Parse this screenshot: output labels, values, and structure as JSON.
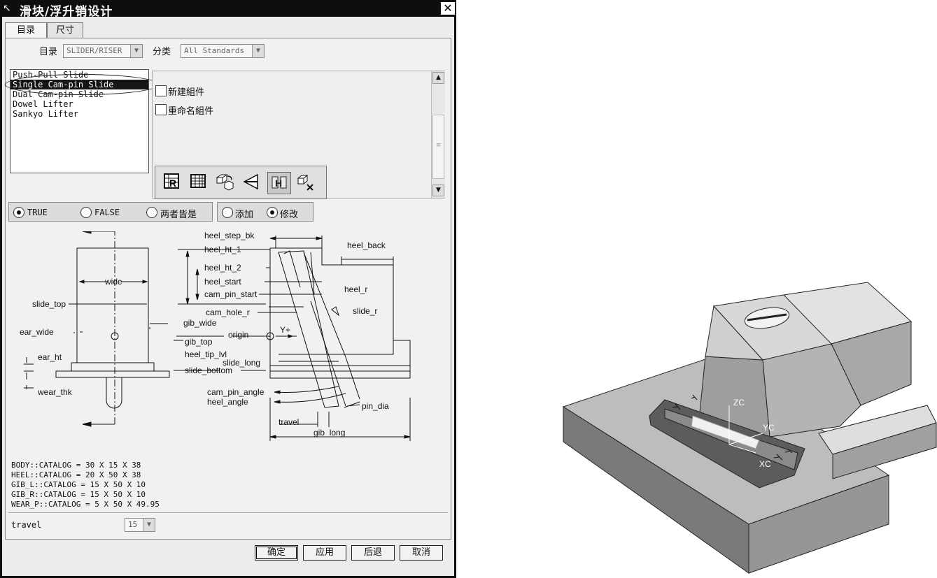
{
  "window": {
    "title": "滑块/浮升销设计",
    "close_glyph": "✕"
  },
  "tabs": [
    {
      "label": "目录",
      "active": true
    },
    {
      "label": "尺寸",
      "active": false
    }
  ],
  "catalog_row": {
    "catalog_label": "目录",
    "catalog_value": "SLIDER/RISER",
    "category_label": "分类",
    "category_value": "All Standards"
  },
  "list": {
    "items": [
      "Push-Pull Slide",
      "Single Cam-pin Slide",
      "Dual Cam-pin Slide",
      "Dowel Lifter",
      "Sankyo Lifter"
    ],
    "selected_index": 1
  },
  "options": {
    "new_component": "新建組件",
    "rename_component": "重命名組件"
  },
  "toolbar_icons": [
    "edit-register-icon",
    "table-icon",
    "redefine-component-icon",
    "plane-icon",
    "view-icon",
    "delete-component-icon"
  ],
  "radios_left": {
    "true_label": "TRUE",
    "false_label": "FALSE",
    "both_label": "两者皆是",
    "selected": "TRUE"
  },
  "radios_right": {
    "add_label": "添加",
    "modify_label": "修改",
    "selected": "修改"
  },
  "diagram_labels": {
    "wide": "wide",
    "slide_top": "slide_top",
    "ear_wide": "ear_wide",
    "ear_ht": "ear_ht",
    "wear_thk": "wear_thk",
    "gib_wide": "gib_wide",
    "gib_top": "gib_top",
    "slide_bottom": "slide_bottom",
    "origin": "origin",
    "y_plus": "Y+",
    "heel_step_bk": "heel_step_bk",
    "heel_ht_1": "heel_ht_1",
    "heel_back": "heel_back",
    "heel_ht_2": "heel_ht_2",
    "heel_start": "heel_start",
    "cam_pin_start": "cam_pin_start",
    "heel_r": "heel_r",
    "cam_hole_r": "cam_hole_r",
    "slide_r": "slide_r",
    "heel_tip_lvl": "heel_tip_lvl",
    "slide_long": "slide_long",
    "cam_pin_angle": "cam_pin_angle",
    "heel_angle": "heel_angle",
    "pin_dia": "pin_dia",
    "travel": "travel",
    "gib_long": "gib_long"
  },
  "catalog_lines": [
    "BODY::CATALOG = 30 X 15 X 38",
    "HEEL::CATALOG = 20 X 50 X 38",
    "GIB_L::CATALOG = 15 X 50 X 10",
    "GIB_R::CATALOG = 15 X 50 X 10",
    "WEAR_P::CATALOG = 5 X 50 X 49.95"
  ],
  "travel": {
    "label": "travel",
    "value": "15"
  },
  "buttons": {
    "ok": "确定",
    "apply": "应用",
    "back": "后退",
    "cancel": "取消"
  },
  "axes_3d": {
    "z": "ZC",
    "y": "YC",
    "x": "XC"
  }
}
